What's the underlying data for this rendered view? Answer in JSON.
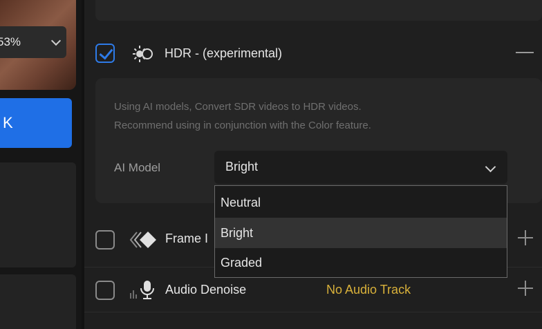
{
  "left": {
    "zoom_value": "53%",
    "button_glyph": "K"
  },
  "hdr": {
    "checked": true,
    "icon": "hdr-sun-icon",
    "title": "HDR - (experimental)",
    "description_line1": "Using AI models, Convert SDR videos to HDR videos.",
    "description_line2": "Recommend using in conjunction with the Color feature.",
    "model_label": "AI Model",
    "model_value": "Bright",
    "model_options": [
      "Neutral",
      "Bright",
      "Graded"
    ],
    "selected_option": "Bright"
  },
  "frame": {
    "checked": false,
    "icon": "frame-interpolation-icon",
    "title": "Frame I"
  },
  "audio": {
    "checked": false,
    "icon": "microphone-icon",
    "title": "Audio Denoise",
    "status": "No Audio Track"
  },
  "colors": {
    "accent": "#1f6fe6",
    "warning": "#d9b13a",
    "background": "#1f1f1f"
  }
}
